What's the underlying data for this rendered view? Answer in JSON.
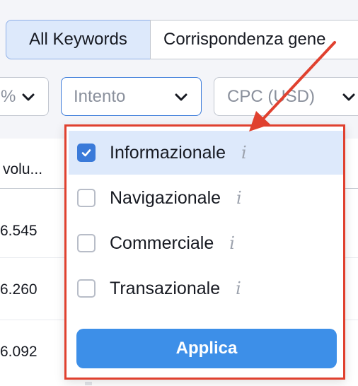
{
  "tabs": {
    "active_label": "All Keywords",
    "other_label": "Corrispondenza gene"
  },
  "filters": {
    "left_partial": "%",
    "intent_label": "Intento",
    "cpc_label": "CPC (USD)"
  },
  "table": {
    "header_partial": "volu...",
    "rows": [
      "6.545",
      "6.260",
      "6.092"
    ]
  },
  "dropdown": {
    "options": [
      {
        "label": "Informazionale",
        "checked": true
      },
      {
        "label": "Navigazionale",
        "checked": false
      },
      {
        "label": "Commerciale",
        "checked": false
      },
      {
        "label": "Transazionale",
        "checked": false
      }
    ],
    "info_glyph": "i",
    "apply_label": "Applica"
  },
  "colors": {
    "accent": "#3d8fe8",
    "highlight_box": "#e0412f",
    "selected_bg": "#dde9fb"
  },
  "icons": [
    "chevron-down-icon",
    "checkmark-icon",
    "info-icon",
    "red-arrow"
  ]
}
